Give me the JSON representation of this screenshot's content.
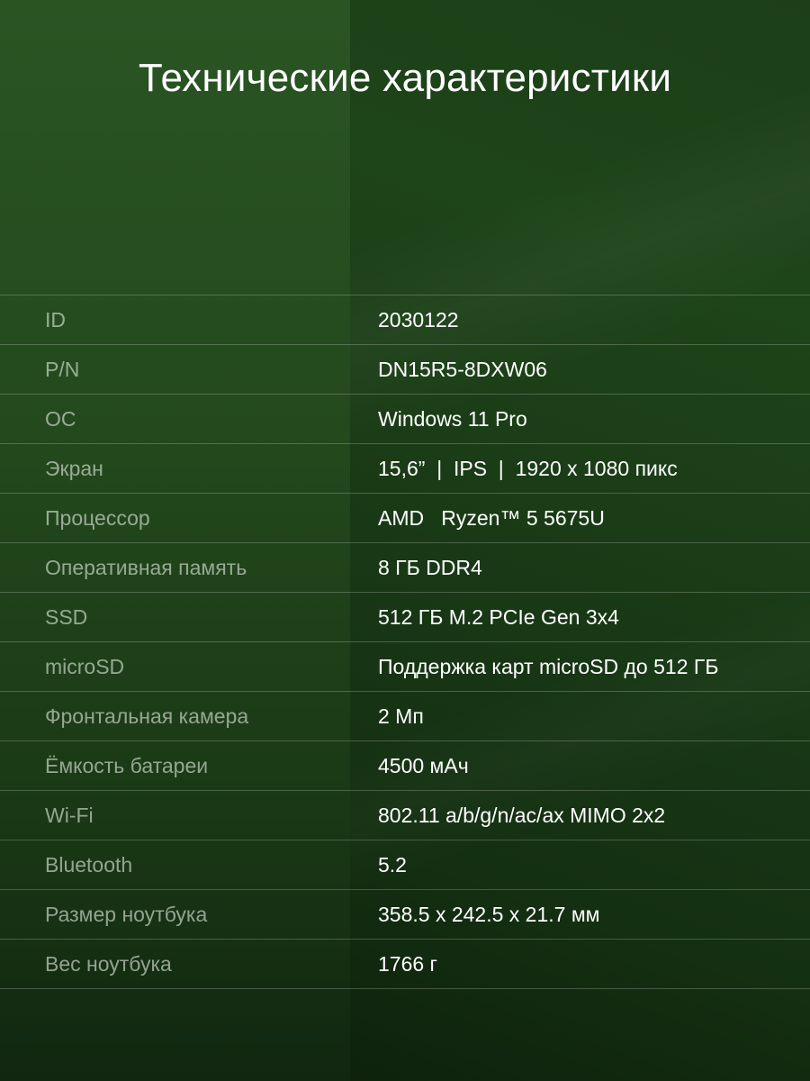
{
  "title": "Технические характеристики",
  "specs": [
    {
      "label": "ID",
      "value": "2030122"
    },
    {
      "label": "P/N",
      "value": "DN15R5-8DXW06"
    },
    {
      "label": "ОС",
      "value": "Windows 11 Pro"
    },
    {
      "label": "Экран",
      "value": "15,6”  |  IPS  |  1920 x 1080 пикс"
    },
    {
      "label": "Процессор",
      "value": "AMD   Ryzen™ 5 5675U"
    },
    {
      "label": "Оперативная память",
      "value": "8 ГБ DDR4"
    },
    {
      "label": "SSD",
      "value": "512 ГБ M.2 PCIe Gen 3x4"
    },
    {
      "label": "microSD",
      "value": "Поддержка карт microSD до 512 ГБ"
    },
    {
      "label": "Фронтальная камера",
      "value": "2 Мп"
    },
    {
      "label": "Ёмкость батареи",
      "value": "4500 мАч"
    },
    {
      "label": "Wi-Fi",
      "value": "802.11 a/b/g/n/ac/ax MIMO 2x2"
    },
    {
      "label": "Bluetooth",
      "value": "5.2"
    },
    {
      "label": "Размер ноутбука",
      "value": "358.5 x 242.5 x 21.7 мм"
    },
    {
      "label": "Вес ноутбука",
      "value": "1766 г"
    }
  ],
  "colors": {
    "background_dark_green": "#1c3a18",
    "panel_left_green": "#2a5523",
    "value_text": "#ffffff",
    "label_text": "#a9b6a4"
  }
}
